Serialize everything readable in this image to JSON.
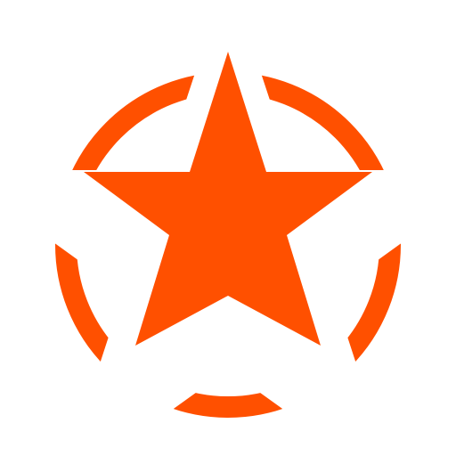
{
  "icon": {
    "name": "star-in-ring-icon",
    "primary_color": "#FF5000",
    "background_color": "#FFFFFF"
  }
}
